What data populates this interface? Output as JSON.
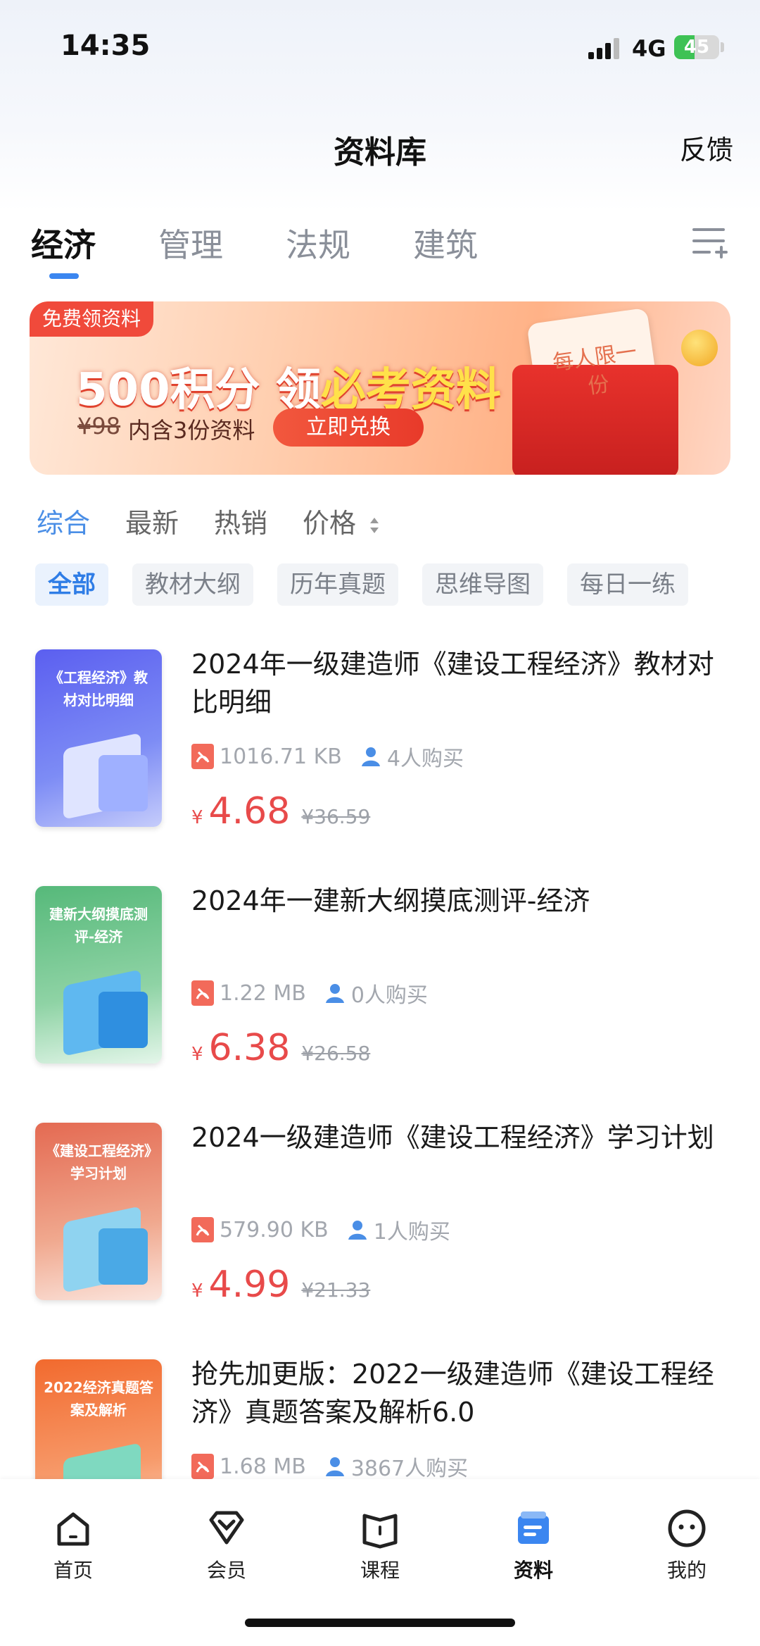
{
  "status": {
    "time": "14:35",
    "network": "4G",
    "battery": "45",
    "battery_level": 0.45
  },
  "header": {
    "title": "资料库",
    "feedback": "反馈"
  },
  "category_tabs": [
    {
      "label": "经济",
      "active": true
    },
    {
      "label": "管理",
      "active": false
    },
    {
      "label": "法规",
      "active": false
    },
    {
      "label": "建筑",
      "active": false
    }
  ],
  "banner": {
    "tag": "免费领资料",
    "title_part1": "500积分 领",
    "title_part2": "必考资料",
    "old_price": "¥98",
    "subtitle": "内含3份资料",
    "button": "立即兑换",
    "envelope_text": "每人限一份"
  },
  "sort": [
    {
      "label": "综合",
      "active": true
    },
    {
      "label": "最新",
      "active": false
    },
    {
      "label": "热销",
      "active": false
    },
    {
      "label": "价格",
      "active": false
    }
  ],
  "filters": [
    {
      "label": "全部",
      "active": true
    },
    {
      "label": "教材大纲",
      "active": false
    },
    {
      "label": "历年真题",
      "active": false
    },
    {
      "label": "思维导图",
      "active": false
    },
    {
      "label": "每日一练",
      "active": false
    }
  ],
  "items": [
    {
      "cover_text": "《工程经济》教材对比明细",
      "title": "2024年一级建造师《建设工程经济》教材对比明细",
      "size": "1016.71 KB",
      "buyers": "4人购买",
      "currency": "¥",
      "price": "4.68",
      "old_price": "¥36.59",
      "cover_color": "#5b6cf0"
    },
    {
      "cover_text": "建新大纲摸底测评-经济",
      "title": "2024年一建新大纲摸底测评-经济",
      "size": "1.22 MB",
      "buyers": "0人购买",
      "currency": "¥",
      "price": "6.38",
      "old_price": "¥26.58",
      "cover_color": "#5fc184"
    },
    {
      "cover_text": "《建设工程经济》学习计划",
      "title": "2024一级建造师《建设工程经济》学习计划",
      "size": "579.90 KB",
      "buyers": "1人购买",
      "currency": "¥",
      "price": "4.99",
      "old_price": "¥21.33",
      "cover_color": "#e8735a"
    },
    {
      "cover_text": "2022经济真题答案及解析",
      "title": "抢先加更版：2022一级建造师《建设工程经济》真题答案及解析6.0",
      "size": "1.68 MB",
      "buyers": "3867人购买",
      "currency": "¥",
      "price": "",
      "old_price": "",
      "cover_color": "#f27a3a"
    }
  ],
  "bottom_nav": [
    {
      "label": "首页",
      "icon": "home-icon",
      "active": false
    },
    {
      "label": "会员",
      "icon": "member-icon",
      "active": false
    },
    {
      "label": "课程",
      "icon": "course-icon",
      "active": false
    },
    {
      "label": "资料",
      "icon": "materials-icon",
      "active": true
    },
    {
      "label": "我的",
      "icon": "profile-icon",
      "active": false
    }
  ],
  "colors": {
    "accent": "#3b86f0",
    "price": "#e84a4a",
    "sort_active": "#4a8ee6"
  }
}
